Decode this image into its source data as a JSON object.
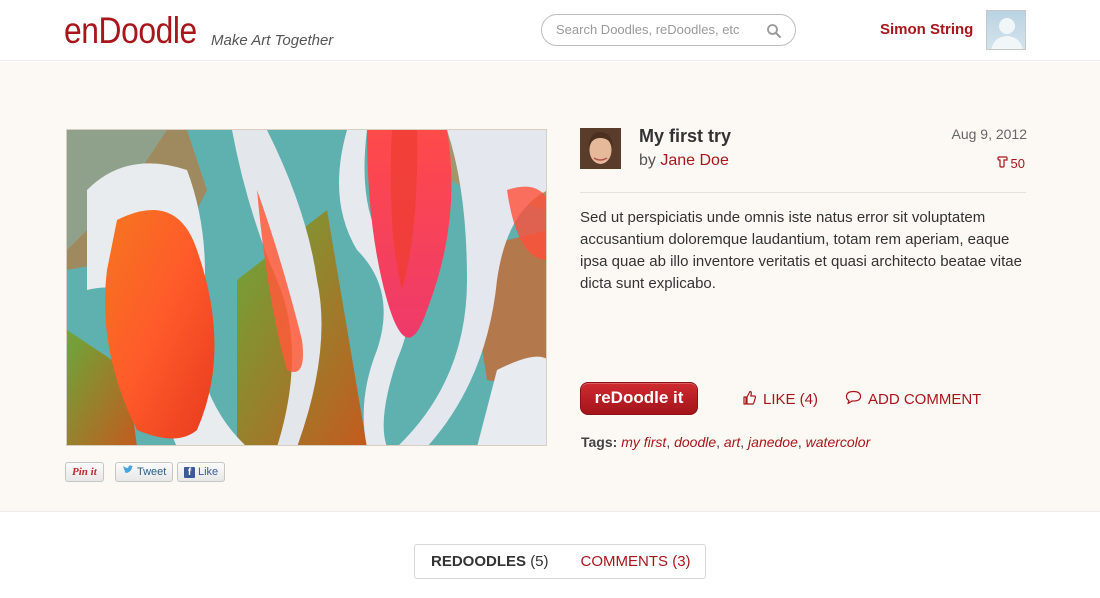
{
  "header": {
    "logo": "enDoodle",
    "tagline": "Make Art Together",
    "search_placeholder": "Search Doodles, reDoodles, etc",
    "user_name": "Simon String"
  },
  "doodle": {
    "title": "My first try",
    "by_prefix": "by",
    "author": "Jane Doe",
    "date": "Aug 9, 2012",
    "redoodle_count": "50",
    "description": "Sed ut perspiciatis unde omnis iste natus error sit voluptatem accusantium doloremque laudantium, totam rem aperiam, eaque ipsa quae ab illo inventore veritatis et quasi architecto beatae vitae dicta sunt explicabo."
  },
  "share": {
    "pin_label": "Pin it",
    "tweet_label": "Tweet",
    "like_label": "Like"
  },
  "actions": {
    "redoodle_button": "reDoodle it",
    "like_label": "LIKE (4)",
    "comment_label": "ADD COMMENT"
  },
  "tags": {
    "label": "Tags:",
    "items": [
      "my first",
      "doodle",
      "art",
      "janedoe",
      "watercolor"
    ]
  },
  "tabs": [
    {
      "label": "REDOODLES",
      "count": "(5)",
      "active": true
    },
    {
      "label": "COMMENTS",
      "count": "(3)",
      "active": false
    }
  ],
  "colors": {
    "brand": "#a8161b",
    "page_background": "#fcf9f4"
  }
}
